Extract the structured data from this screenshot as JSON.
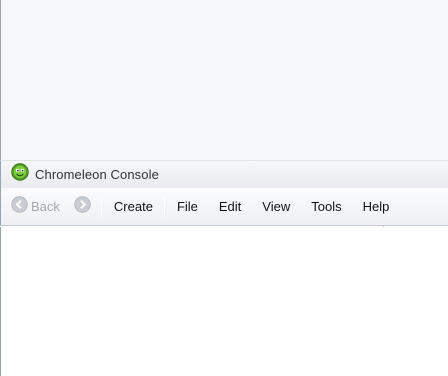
{
  "window": {
    "title": "Chromeleon Console",
    "icon": "chromeleon-app-icon"
  },
  "toolbar": {
    "back_label": "Back",
    "back_icon": "back-arrow-icon",
    "forward_icon": "forward-arrow-icon"
  },
  "menu": {
    "items": [
      {
        "label": "Create"
      },
      {
        "label": "File"
      },
      {
        "label": "Edit"
      },
      {
        "label": "View"
      },
      {
        "label": "Tools"
      },
      {
        "label": "Help"
      }
    ]
  },
  "colors": {
    "accent_green": "#5fb52c",
    "disabled_text": "#a6aab0"
  }
}
